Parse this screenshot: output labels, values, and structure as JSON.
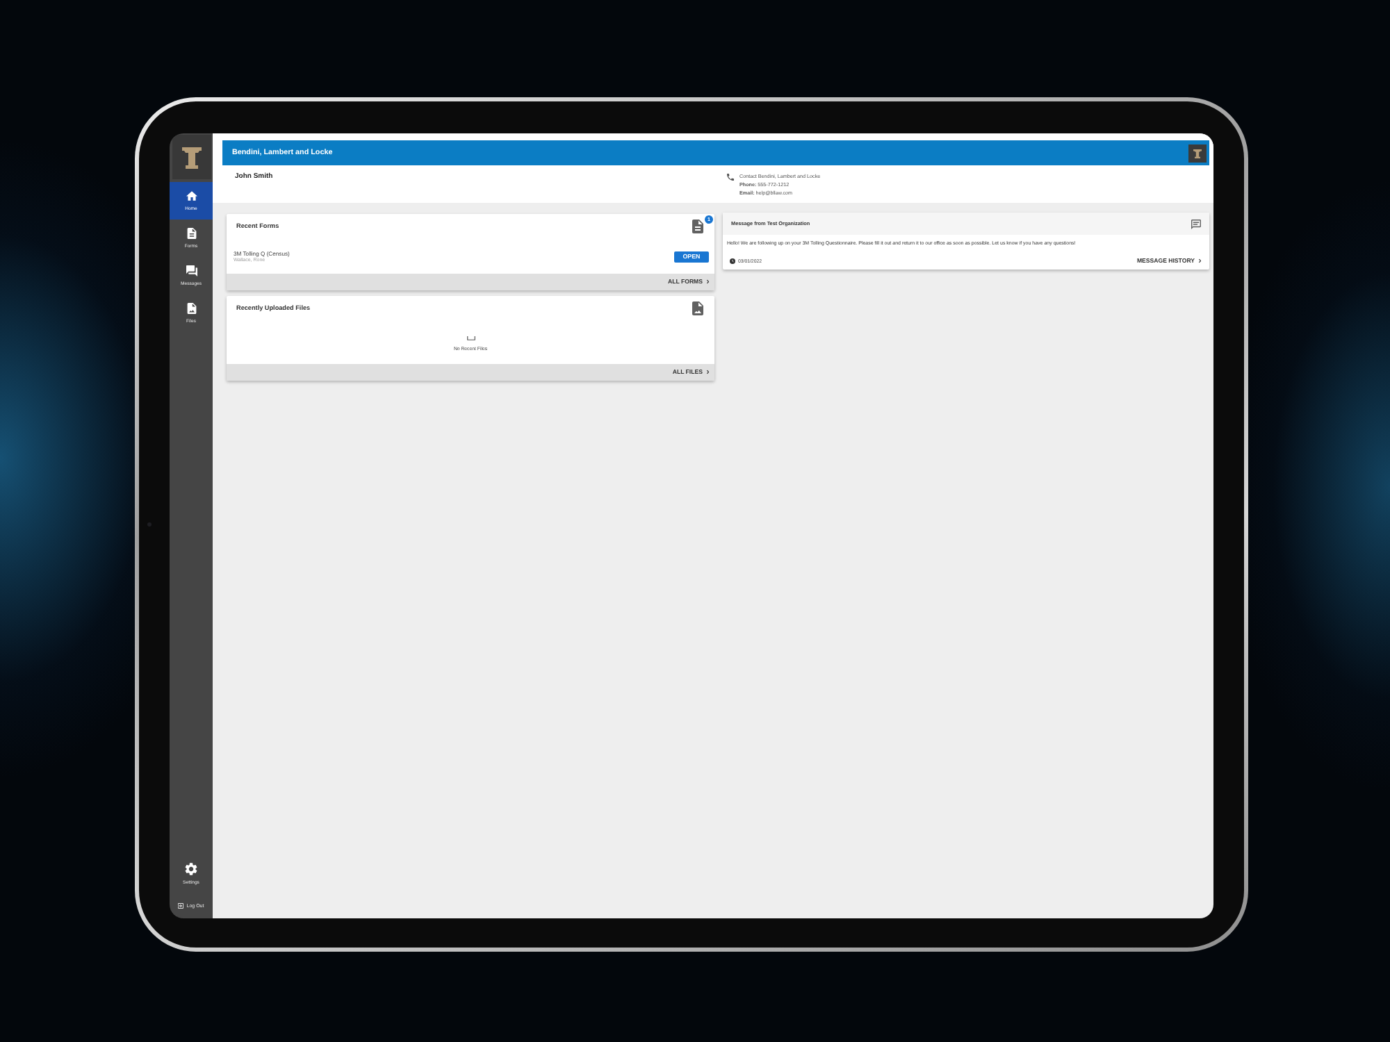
{
  "header": {
    "title": "Bendini, Lambert and Locke"
  },
  "sidebar": {
    "nav": [
      {
        "label": "Home",
        "selected": true
      },
      {
        "label": "Forms",
        "selected": false
      },
      {
        "label": "Messages",
        "selected": false
      },
      {
        "label": "Files",
        "selected": false
      }
    ],
    "settings": "Settings",
    "logout": "Log Out"
  },
  "user": {
    "name": "John Smith"
  },
  "contact": {
    "title": "Contact Bendini, Lambert and Locke",
    "lines": [
      "**Phone:** 555-772-1212",
      "**Email:** help@bllaw.com"
    ]
  },
  "recent_forms": {
    "title": "Recent Forms",
    "badge": "1",
    "items": [
      {
        "name": "3M Tolling Q (Census)",
        "client": "Wallace, Rone",
        "action": "OPEN"
      }
    ],
    "footer_link": "ALL FORMS"
  },
  "recent_files": {
    "title": "Recently Uploaded Files",
    "empty_text": "No Recent Files",
    "footer_link": "ALL FILES"
  },
  "message": {
    "title": "Message from Test Organization",
    "body": "Hello! We are following up on your 3M Tolling Questionnaire. Please fill it out and return it to our office as soon as possible. Let us know if you have any questions!",
    "date": "03/01/2022",
    "footer_link": "MESSAGE HISTORY"
  }
}
